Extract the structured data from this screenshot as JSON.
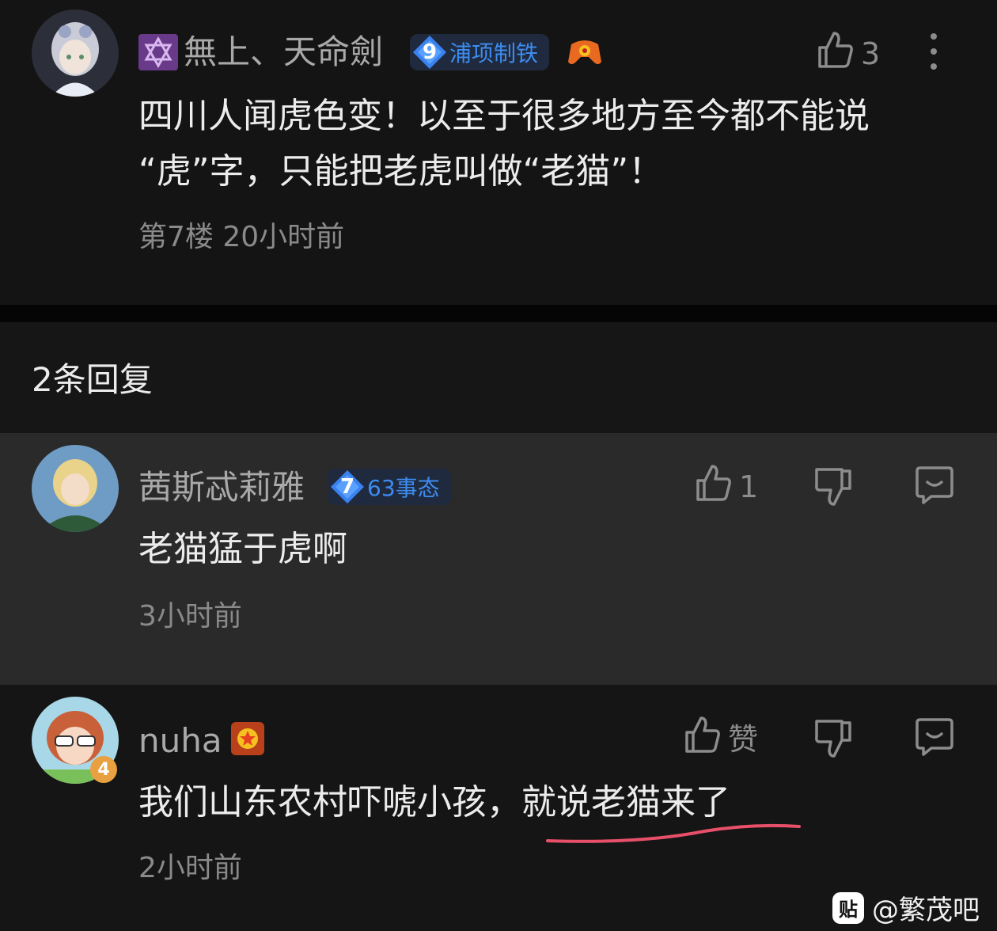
{
  "post": {
    "user_prefix_icon": "hexagram-icon",
    "username": "無上、天命劍",
    "badge": {
      "level": "9",
      "text": "浦项制铁"
    },
    "extra_icon": "game-controller-icon",
    "like_count": "3",
    "content_line1": "四川人闻虎色变！以至于很多地方至今都不能说",
    "content_line2": "“虎”字，只能把老虎叫做“老猫”！",
    "meta": "第7楼 20小时前"
  },
  "replies_header": "2条回复",
  "replies": [
    {
      "username": "茜斯忒莉雅",
      "badge": {
        "level": "7",
        "text": "63事态"
      },
      "like_count": "1",
      "content": "老猫猛于虎啊",
      "meta": "3小时前"
    },
    {
      "username": "nuha",
      "avatar_level": "4",
      "like_label": "赞",
      "content_plain": "我们山东农村吓唬小孩，",
      "content_underlined": "就说老猫来了",
      "meta": "2小时前"
    }
  ],
  "colors": {
    "underline": "#e8506a",
    "badge_text": "#3d8cf0",
    "gem": "#3a82f0"
  },
  "watermark": {
    "icon_text": "贴",
    "text": "@繁茂吧"
  }
}
